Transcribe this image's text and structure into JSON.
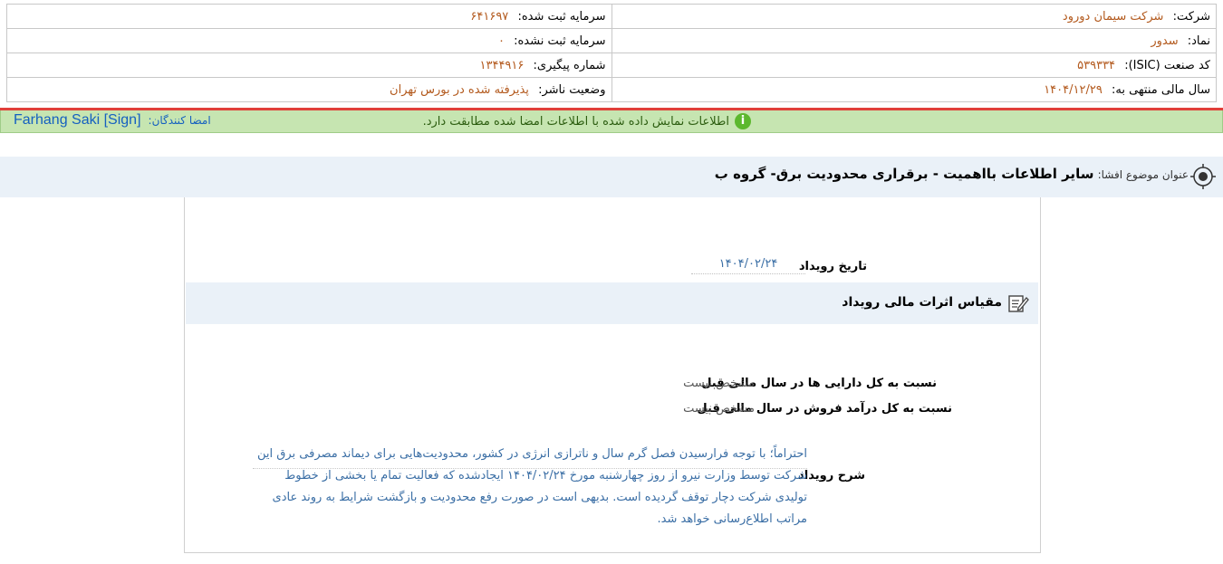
{
  "header": {
    "company_label": "شرکت:",
    "company_value": "شرکت سیمان دورود",
    "capital_registered_label": "سرمایه ثبت شده:",
    "capital_registered_value": "۶۴۱۶۹۷",
    "symbol_label": "نماد:",
    "symbol_value": "سدور",
    "capital_unregistered_label": "سرمایه ثبت نشده:",
    "capital_unregistered_value": "۰",
    "isic_label": "کد صنعت (ISIC):",
    "isic_value": "۵۳۹۳۳۴",
    "tracking_label": "شماره پیگیری:",
    "tracking_value": "۱۳۴۴۹۱۶",
    "fiscal_year_label": "سال مالی منتهی به:",
    "fiscal_year_value": "۱۴۰۴/۱۲/۲۹",
    "publisher_status_label": "وضعیت ناشر:",
    "publisher_status_value": "پذیرفته شده در بورس تهران"
  },
  "signature": {
    "verify_text": "اطلاعات نمایش داده شده با اطلاعات امضا شده مطابقت دارد.",
    "signers_label": "امضا کنندگان:",
    "signer_name": "Farhang Saki [Sign]",
    "icon": "info-icon"
  },
  "topic": {
    "label": "عنوان موضوع افشا:",
    "value": "سایر اطلاعات بااهمیت - برقراری محدودیت برق- گروه ب",
    "icon": "target-icon"
  },
  "event": {
    "date_label": "تاریخ رویداد",
    "date_value": "۱۴۰۴/۰۲/۲۴",
    "section_title": "مقیاس اثرات مالی رویداد",
    "section_icon": "edit-document-icon",
    "assets_label": "نسبت به کل دارایی ها در سال مالی قبل",
    "assets_value": "مشخص نیست",
    "revenue_label": "نسبت به کل درآمد فروش در سال مالی قبل",
    "revenue_value": "مشخص نیست",
    "description_label": "شرح رویداد",
    "description_text": "احتراماً؛ با توجه فرارسیدن فصل گرم سال و ناترازی انرژی در کشور، محدودیت‌هایی برای دیماند مصرفی برق این شرکت توسط وزارت نیرو از روز چهارشنبه مورخ ۱۴۰۴/۰۲/۲۴ ایجادشده که فعالیت تمام یا بخشی از خطوط تولیدی شرکت دچار توقف گردیده است. بدیهی است در صورت رفع محدودیت و بازگشت شرایط به روند عادی مراتب اطلاع‌رسانی خواهد شد."
  }
}
